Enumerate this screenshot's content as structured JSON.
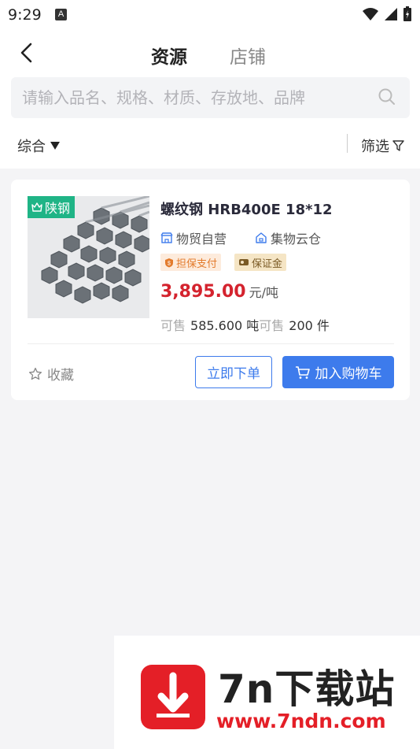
{
  "status_bar": {
    "time": "9:29",
    "notification_letter": "A"
  },
  "header": {
    "tabs": [
      {
        "label": "资源",
        "active": true
      },
      {
        "label": "店铺",
        "active": false
      }
    ]
  },
  "search": {
    "placeholder": "请输入品名、规格、材质、存放地、品牌"
  },
  "sort_bar": {
    "sort_label": "综合",
    "filter_label": "筛选"
  },
  "product": {
    "brand_tag": "陕钢",
    "title": "螺纹钢 HRB400E 18*12",
    "seller_type": "物贸自营",
    "warehouse": "集物云仓",
    "badges": [
      "担保支付",
      "保证金"
    ],
    "price": "3,895.00",
    "price_unit": "元/吨",
    "stock_label_1": "可售",
    "stock_weight": "585.600 吨",
    "stock_label_2": "可售",
    "stock_count": "200 件",
    "favorite_label": "收藏",
    "buy_now_label": "立即下单",
    "add_cart_label": "加入购物车"
  },
  "watermark": {
    "title": "7n下载站",
    "url": "www.7ndn.com"
  },
  "colors": {
    "accent": "#3d7bec",
    "price": "#d4232e",
    "brand_tag": "#1fb486"
  }
}
